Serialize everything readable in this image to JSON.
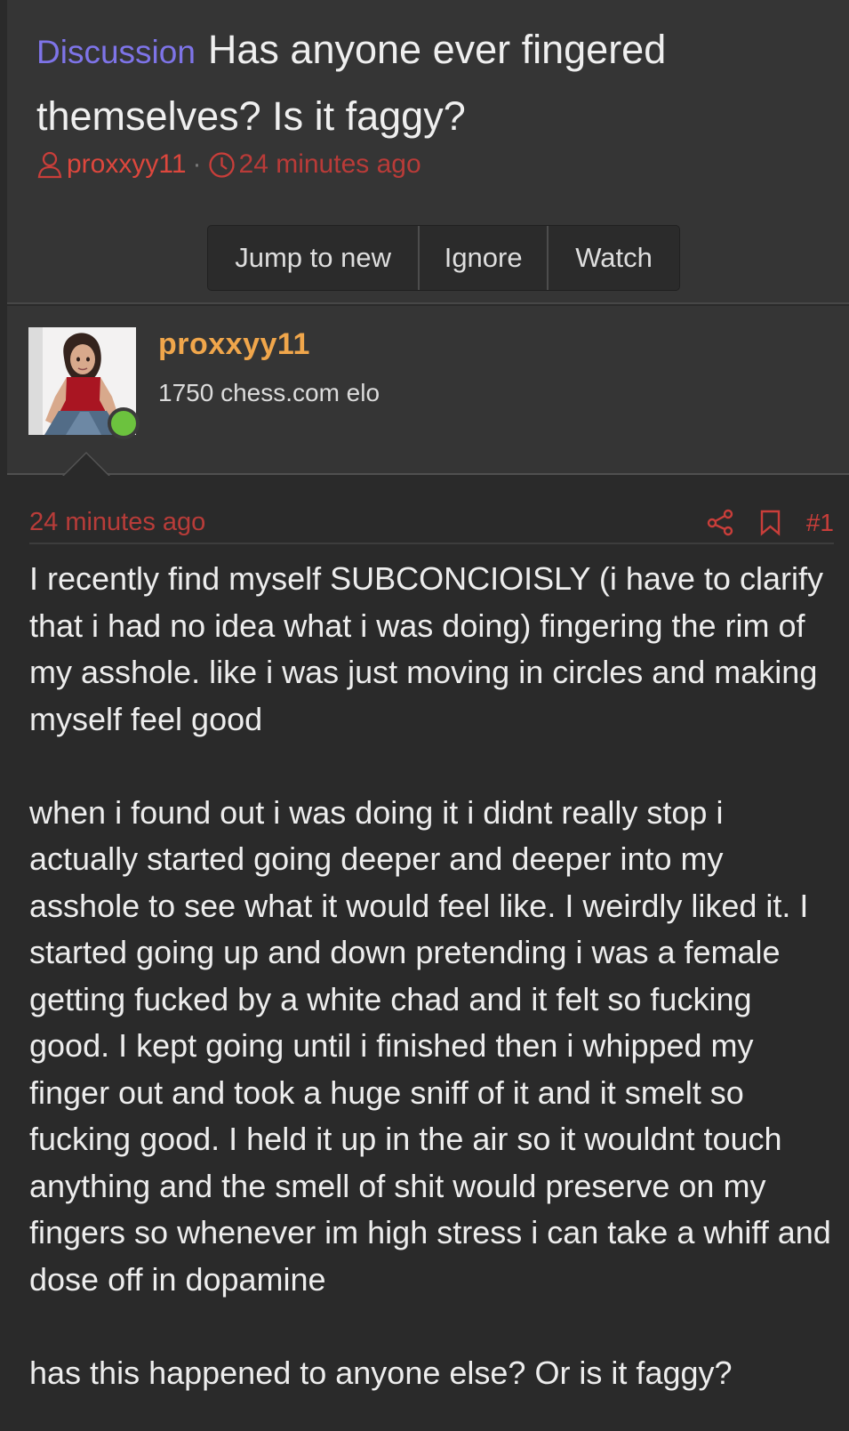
{
  "thread": {
    "prefix": "Discussion",
    "title": "Has anyone ever fingered themselves? Is it faggy?",
    "author": "proxxyy11",
    "time": "24 minutes ago"
  },
  "actions": {
    "jump": "Jump to new",
    "ignore": "Ignore",
    "watch": "Watch"
  },
  "user": {
    "name": "proxxyy11",
    "title": "1750 chess.com elo"
  },
  "post": {
    "time": "24 minutes ago",
    "number": "#1",
    "paragraphs": [
      "I recently find myself SUBCONCIOISLY (i have to clarify that i had no idea what i was doing) fingering the rim of my asshole. like i was just moving in circles and making myself feel good",
      "when i found out i was doing it i didnt really stop i actually started going deeper and deeper into my asshole to see what it would feel like. I weirdly liked it. I started going up and down pretending i was a female getting fucked by a white chad and it felt so fucking good. I kept going until i finished then i whipped my finger out and took a huge sniff of it and it smelt so fucking good. I held it up in the air so it wouldnt touch anything and the smell of shit would preserve on my fingers so whenever im high stress i can take a whiff and dose off in dopamine",
      "has this happened to anyone else? Or is it faggy?"
    ]
  },
  "icons": {
    "author": "user-outline-icon",
    "clock": "clock-icon",
    "share": "share-icon",
    "bookmark": "bookmark-icon",
    "online": "online-status-icon"
  },
  "colors": {
    "prefix": "#7e74e8",
    "accent": "#c93e3a",
    "username": "#f0a64b",
    "online": "#6cc23e"
  }
}
